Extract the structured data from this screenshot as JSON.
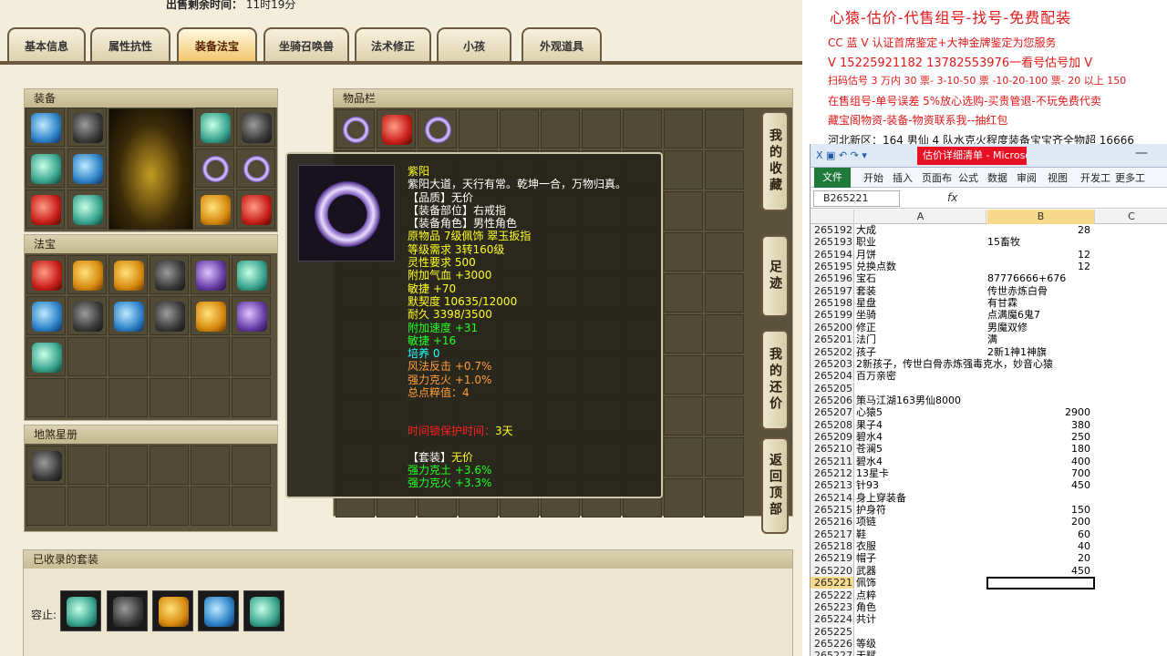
{
  "game": {
    "top_label": "出售剩余时间：",
    "top_value": "11时19分",
    "tabs": [
      "基本信息",
      "属性抗性",
      "装备法宝",
      "坐骑召唤兽",
      "法术修正",
      "小孩",
      "外观道具"
    ],
    "active_tab": "装备法宝",
    "equip_title": "装备",
    "fabao_title": "法宝",
    "dishaxingce_title": "地煞星册",
    "items_title": "物品栏",
    "side_buttons": [
      "我的收藏",
      "足迹",
      "我的还价",
      "返回顶部"
    ],
    "sets_title": "已收录的套装",
    "sets_label": "容止:"
  },
  "tooltip": {
    "name": "紫阳",
    "desc": "紫阳大道，天行有常。乾坤一合，万物归真。",
    "quality": "【品质】无价",
    "slot": "【装备部位】右戒指",
    "role": "【装备角色】男性角色",
    "source": "原物品 7级佩饰 翠玉扳指",
    "level": "等级需求 3转160级",
    "spirit": "灵性要求 500",
    "hp": "附加气血 +3000",
    "agility": "敏捷 +70",
    "tacit": "默契度 10635/12000",
    "durability": "耐久 3398/3500",
    "speed": "附加速度 +31",
    "agility2": "敏捷 +16",
    "cultivate": "培养 0",
    "wind": "风法反击 +0.7%",
    "fire": "强力克火 +1.0%",
    "total": "总点粹值：4",
    "protect_label": "时间锁保护时间：",
    "protect_value": "3天",
    "set_label": "【套装】",
    "set_value": "无价",
    "set_earth": "强力克土 +3.6%",
    "set_fire": "强力克火 +3.3%"
  },
  "ad": {
    "line1": "心猿-估价-代售组号-找号-免费配装",
    "line2": "CC 蓝 V 认证首席鉴定+大神金牌鉴定为您服务",
    "line3": "V 15225921182      13782553976一看号估号加 V",
    "line4": "扫码估号 3 万内 30 票- 3-10-50 票  -10-20-100 票- 20 以上 150",
    "line5": "在售组号-单号误差 5%放心选购-买贵管退-不玩免费代卖",
    "line6": "藏宝阁物资-装备-物资联系我--抽红包",
    "line7": "河北新区：164 男仙 4 队水克火程度装备宝宝齐全物超 16666"
  },
  "excel": {
    "title": "估价详细清单 - Microsoft Excel(产品...",
    "ribbon_tabs": [
      "文件",
      "开始",
      "插入",
      "页面布",
      "公式",
      "数据",
      "审阅",
      "视图",
      "开发工",
      "更多工"
    ],
    "name_box": "B265221",
    "fx": "fx",
    "columns": [
      "A",
      "B",
      "C"
    ],
    "rows": [
      {
        "n": "265192",
        "a": "大成",
        "b": "28",
        "num": true
      },
      {
        "n": "265193",
        "a": "职业",
        "b": "15畜牧",
        "num": false
      },
      {
        "n": "265194",
        "a": "月饼",
        "b": "12",
        "num": true
      },
      {
        "n": "265195",
        "a": "兑换点数",
        "b": "12",
        "num": true
      },
      {
        "n": "265196",
        "a": "宝石",
        "b": "87776666+676",
        "num": false
      },
      {
        "n": "265197",
        "a": "套装",
        "b": "传世赤炼白骨",
        "num": false
      },
      {
        "n": "265198",
        "a": "星盘",
        "b": "有甘霖",
        "num": false
      },
      {
        "n": "265199",
        "a": "坐骑",
        "b": "点满魔6鬼7",
        "num": false
      },
      {
        "n": "265200",
        "a": "修正",
        "b": "男魔双修",
        "num": false
      },
      {
        "n": "265201",
        "a": "法门",
        "b": "满",
        "num": false
      },
      {
        "n": "265202",
        "a": "孩子",
        "b": "2新1神1神旗",
        "num": false
      },
      {
        "n": "265203",
        "a": "2新孩子，传世白骨赤炼强毒克水，妙音心猿",
        "b": "",
        "num": false
      },
      {
        "n": "265204",
        "a": "百万亲密",
        "b": "",
        "num": false
      },
      {
        "n": "265205",
        "a": "",
        "b": "",
        "num": false
      },
      {
        "n": "265206",
        "a": "策马江湖163男仙8000",
        "b": "",
        "num": false
      },
      {
        "n": "265207",
        "a": "心猿5",
        "b": "2900",
        "num": true
      },
      {
        "n": "265208",
        "a": "果子4",
        "b": "380",
        "num": true
      },
      {
        "n": "265209",
        "a": "碧水4",
        "b": "250",
        "num": true
      },
      {
        "n": "265210",
        "a": "苍澜5",
        "b": "180",
        "num": true
      },
      {
        "n": "265211",
        "a": "碧水4",
        "b": "400",
        "num": true
      },
      {
        "n": "265212",
        "a": "13星卡",
        "b": "700",
        "num": true
      },
      {
        "n": "265213",
        "a": "针93",
        "b": "450",
        "num": true
      },
      {
        "n": "265214",
        "a": "身上穿装备",
        "b": "",
        "num": false
      },
      {
        "n": "265215",
        "a": "护身符",
        "b": "150",
        "num": true
      },
      {
        "n": "265216",
        "a": "项链",
        "b": "200",
        "num": true
      },
      {
        "n": "265217",
        "a": "鞋",
        "b": "60",
        "num": true
      },
      {
        "n": "265218",
        "a": "衣服",
        "b": "40",
        "num": true
      },
      {
        "n": "265219",
        "a": "帽子",
        "b": "20",
        "num": true
      },
      {
        "n": "265220",
        "a": "武器",
        "b": "450",
        "num": true
      },
      {
        "n": "265221",
        "a": "佩饰",
        "b": "",
        "num": false
      },
      {
        "n": "265222",
        "a": "点粹",
        "b": "",
        "num": false
      },
      {
        "n": "265223",
        "a": "角色",
        "b": "",
        "num": false
      },
      {
        "n": "265224",
        "a": "共计",
        "b": "",
        "num": false
      },
      {
        "n": "265225",
        "a": "",
        "b": "",
        "num": false
      },
      {
        "n": "265226",
        "a": "等级",
        "b": "",
        "num": false
      },
      {
        "n": "265227",
        "a": "天赋",
        "b": "",
        "num": false
      }
    ],
    "selected_row": "265221"
  }
}
